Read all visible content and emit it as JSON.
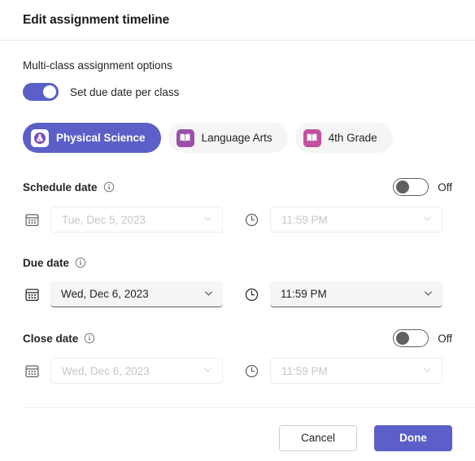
{
  "theme": {
    "accent": "#5b5fc7",
    "chip_bg": "#f5f5f5",
    "field_bg": "#f5f5f5",
    "disabled_text": "#c8c6c4",
    "text": "#242424"
  },
  "header": {
    "title": "Edit assignment timeline"
  },
  "multiclass": {
    "section_label": "Multi-class assignment options",
    "toggle": {
      "state": "on",
      "label": "Set due date per class"
    }
  },
  "classes": [
    {
      "name": "Physical Science",
      "selected": true,
      "icon": "flask-icon",
      "icon_bg": "#ffffff",
      "icon_fg": "#7b4fb5"
    },
    {
      "name": "Language Arts",
      "selected": false,
      "icon": "book-icon",
      "icon_bg": "#9b4fa8",
      "icon_fg": "#ffffff"
    },
    {
      "name": "4th Grade",
      "selected": false,
      "icon": "book-icon",
      "icon_bg": "#c34fa0",
      "icon_fg": "#ffffff"
    }
  ],
  "sections": [
    {
      "label": "Schedule date",
      "has_toggle": true,
      "toggle_state": "off",
      "toggle_state_label": "Off",
      "enabled": false,
      "date_value": "Tue, Dec 5, 2023",
      "time_value": "11:59 PM"
    },
    {
      "label": "Due date",
      "has_toggle": false,
      "toggle_state": "",
      "toggle_state_label": "",
      "enabled": true,
      "date_value": "Wed, Dec 6, 2023",
      "time_value": "11:59 PM"
    },
    {
      "label": "Close date",
      "has_toggle": true,
      "toggle_state": "off",
      "toggle_state_label": "Off",
      "enabled": false,
      "date_value": "Wed, Dec 6, 2023",
      "time_value": "11:59 PM"
    }
  ],
  "footer": {
    "cancel_label": "Cancel",
    "done_label": "Done"
  }
}
